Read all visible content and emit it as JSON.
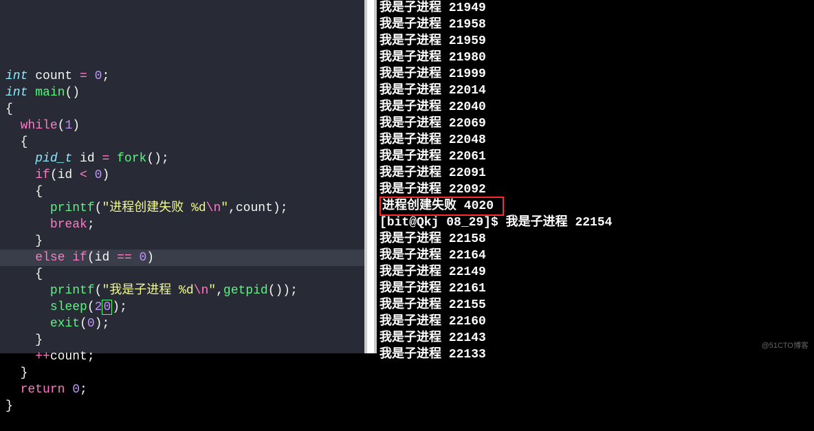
{
  "code": {
    "decls": {
      "int1": "int",
      "count": "count",
      "eq": "=",
      "zero": "0",
      "semi": ";",
      "int2": "int",
      "mainfn": "main",
      "paren": "()"
    },
    "body": {
      "lbrace": "{",
      "while_kw": "while",
      "while_cond_l": "(",
      "one": "1",
      "while_cond_r": ")",
      "w_lb": "{",
      "pidt": "pid_t",
      "id": "id",
      "eq2": "=",
      "fork": "fork",
      "forkp": "();",
      "if_kw": "if",
      "if_l": "(id ",
      "lt": "<",
      "if_z": " 0",
      "if_r": ")",
      "if_lb": "{",
      "printf1": "printf",
      "p1_l": "(",
      "str1a": "\"进程创建失败 ",
      "fmt1": "%d",
      "esc1": "\\n",
      "str1b": "\"",
      "p1_m": ",count);",
      "break_kw": "break",
      "break_s": ";",
      "if_rb": "}",
      "else_kw": "else if",
      "ei_l": "(id ",
      "eqeq": "==",
      "ei_z": " 0",
      "ei_r": ")",
      "ei_lb": "{",
      "printf2": "printf",
      "p2_l": "(",
      "str2a": "\"我是子进程 ",
      "fmt2": "%d",
      "esc2": "\\n",
      "str2b": "\"",
      "p2_m": ",",
      "getpid": "getpid",
      "p2_e": "());",
      "sleep": "sleep",
      "sl_l": "(",
      "sl_2": "2",
      "sl_0": "0",
      "sl_r": ");",
      "exit": "exit",
      "ex_l": "(",
      "ex_0": "0",
      "ex_r": ");",
      "ei_rb": "}",
      "pp": "++",
      "cnt2": "count;",
      "w_rb": "}",
      "ret_kw": "return",
      "ret_sp": " ",
      "ret_0": "0",
      "ret_s": ";",
      "rbrace": "}"
    }
  },
  "terminal": {
    "child_prefix": "我是子进程 ",
    "lines_before": [
      "21949",
      "21958",
      "21959",
      "21980",
      "21999",
      "22014",
      "22040",
      "22069",
      "22048",
      "22061",
      "22091",
      "22092"
    ],
    "fail_line": "进程创建失败 4020 ",
    "prompt": "[bit@Qkj 08_29]$ ",
    "prompt_after": "我是子进程 22154",
    "lines_after": [
      "22158",
      "22164",
      "22149",
      "22161",
      "22155",
      "22160",
      "22143",
      "22133"
    ]
  },
  "watermark": "@51CTO博客"
}
